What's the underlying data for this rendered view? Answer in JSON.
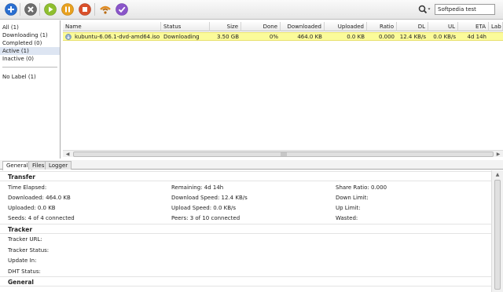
{
  "toolbar": {
    "buttons": [
      {
        "name": "add-torrent-button",
        "icon": "plus-icon",
        "color": "#2a6fd1"
      },
      {
        "name": "remove-torrent-button",
        "icon": "close-icon",
        "color": "#6d6d6d"
      },
      {
        "name": "resume-torrent-button",
        "icon": "play-icon",
        "color": "#8fbf2f"
      },
      {
        "name": "pause-torrent-button",
        "icon": "pause-icon",
        "color": "#e8a11f"
      },
      {
        "name": "stop-torrent-button",
        "icon": "stop-icon",
        "color": "#d9502a"
      },
      {
        "name": "rss-button",
        "icon": "rss-icon",
        "color": "#e08a20"
      },
      {
        "name": "check-button",
        "icon": "check-icon",
        "color": "#8a55c9"
      }
    ],
    "search_value": "Softpedia test"
  },
  "sidebar": {
    "state_items": [
      "All (1)",
      "Downloading (1)",
      "Completed (0)",
      "Active (1)",
      "Inactive (0)"
    ],
    "selected_index": 3,
    "label_items": [
      "No Label (1)"
    ]
  },
  "list": {
    "columns": [
      "Name",
      "Status",
      "Size",
      "Done",
      "Downloaded",
      "Uploaded",
      "Ratio",
      "DL",
      "UL",
      "ETA",
      "Lab"
    ],
    "rows": [
      {
        "name": "kubuntu-6.06.1-dvd-amd64.iso",
        "status": "Downloading",
        "size": "3.50 GB",
        "done": "0%",
        "downloaded": "464.0 KB",
        "uploaded": "0.0 KB",
        "ratio": "0.000",
        "dl": "12.4 KB/s",
        "ul": "0.0 KB/s",
        "eta": "4d 14h",
        "label": ""
      }
    ],
    "row_highlight_color": "#fbfb9a"
  },
  "tabs": [
    "General",
    "Files",
    "Logger"
  ],
  "details": {
    "sections": {
      "transfer": "Transfer",
      "tracker": "Tracker",
      "general": "General"
    },
    "transfer": {
      "time_elapsed": "Time Elapsed:",
      "remaining": "Remaining: 4d 14h",
      "share_ratio": "Share Ratio: 0.000",
      "downloaded": "Downloaded: 464.0 KB",
      "download_speed": "Download Speed: 12.4 KB/s",
      "down_limit": "Down Limit:",
      "uploaded": "Uploaded: 0.0 KB",
      "upload_speed": "Upload Speed: 0.0 KB/s",
      "up_limit": "Up Limit:",
      "seeds": "Seeds: 4 of 4 connected",
      "peers": "Peers: 3 of 10 connected",
      "wasted": "Wasted:"
    },
    "tracker": {
      "url": "Tracker URL:",
      "status": "Tracker Status:",
      "update_in": "Update In:",
      "dht_status": "DHT Status:"
    }
  }
}
